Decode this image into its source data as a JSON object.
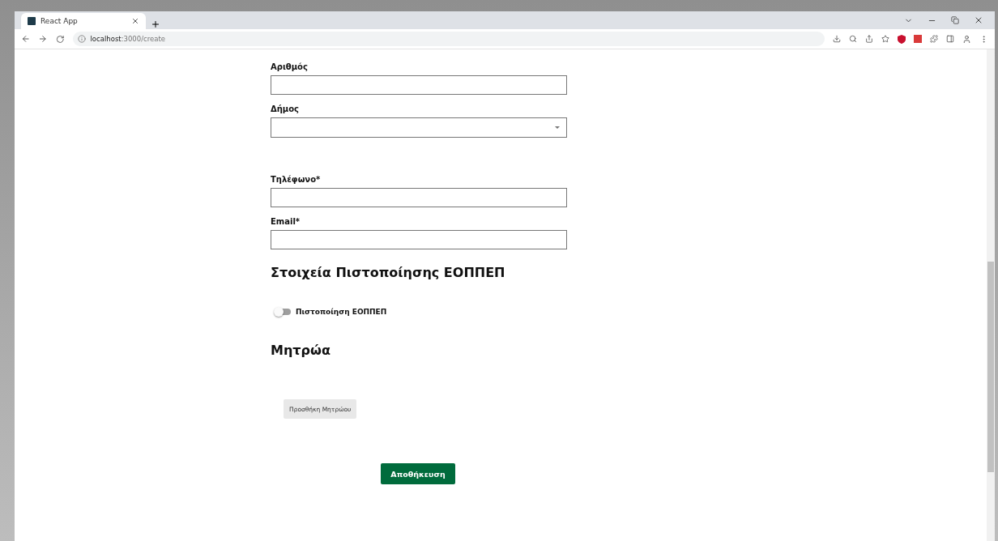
{
  "browser": {
    "tab": {
      "title": "React App",
      "selected": true
    },
    "url": "**localhost**:3000/create"
  },
  "form": [
    {
      "kind": "field",
      "label": "Αριθμός"
    },
    {
      "kind": "select",
      "label": "Δήμος"
    },
    {
      "kind": "field",
      "label": "Τηλέφωνο*"
    },
    {
      "kind": "field",
      "label": "Email*"
    },
    {
      "kind": "heading",
      "label": "Στοιχεία Πιστοποίησης ΕΟΠΠΕΠ"
    },
    {
      "kind": "toggle",
      "label": "Πιστοποίηση ΕΟΠΠΕΠ",
      "on": false
    },
    {
      "kind": "heading",
      "label": "Μητρώα"
    },
    {
      "kind": "secondary",
      "label": "Προσθήκη Μητρώου"
    },
    {
      "kind": "primary",
      "label": "Αποθήκευση"
    }
  ]
}
